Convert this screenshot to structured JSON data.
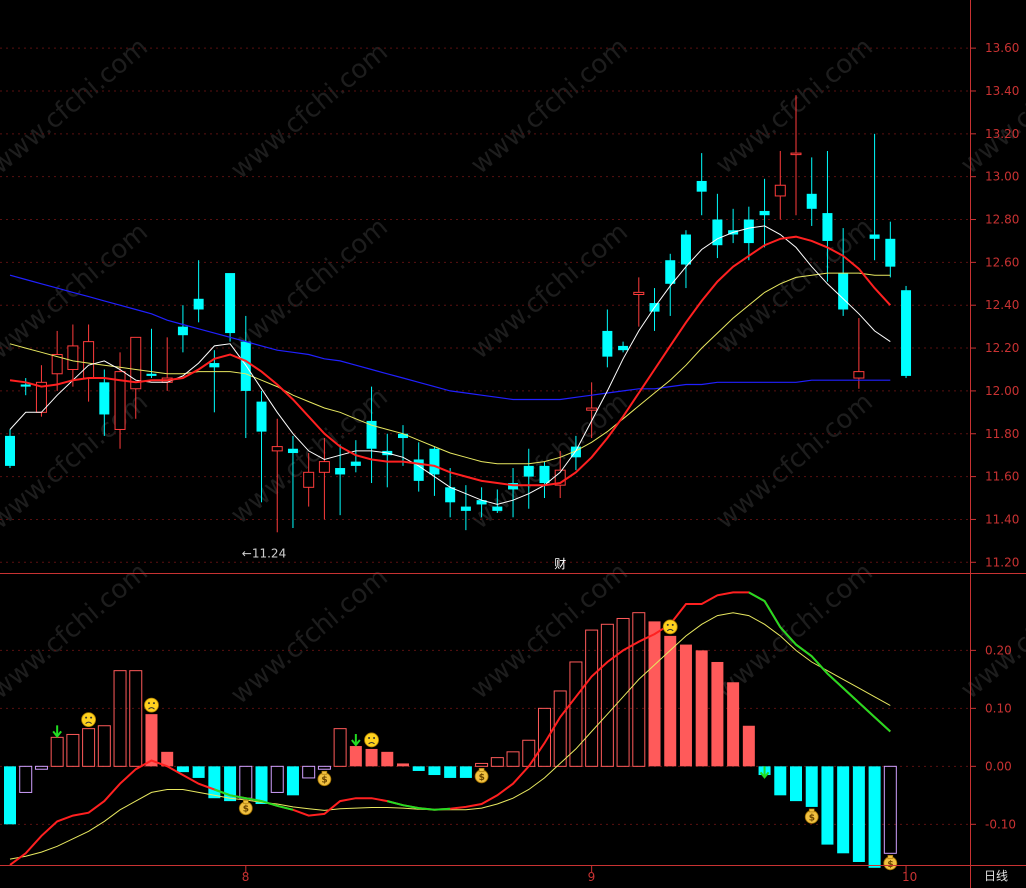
{
  "colors": {
    "background": "#000000",
    "axis_red": "#c83232",
    "up_candle": "#ff3c3c",
    "down_candle": "#00ffff",
    "ma_white": "#ffffff",
    "ma_red": "#ff2020",
    "ma_yellow": "#e8e860",
    "ma_blue": "#2020ff",
    "macd_pos": "#ff5a5a",
    "macd_neg": "#00ffff",
    "dif_green": "#22dd22"
  },
  "watermark": "www.cfchi.com",
  "finance_marker": "财",
  "period_label": "日线",
  "icons": {
    "sad_face": "sad-face-icon",
    "money_bag": "money-bag-icon",
    "down_arrow": "green-down-arrow-icon"
  },
  "chart_data": [
    {
      "type": "candlestick",
      "y_ticks": [
        "13.60",
        "13.40",
        "13.20",
        "13.00",
        "12.80",
        "12.60",
        "12.40",
        "12.20",
        "12.00",
        "11.80",
        "11.60",
        "11.40",
        "11.20"
      ],
      "ylim": [
        11.15,
        13.75
      ],
      "x_ticks": [
        {
          "label": "8",
          "index": 15
        },
        {
          "label": "9",
          "index": 37
        },
        {
          "label": "10",
          "index": 57
        }
      ],
      "low_annotation": {
        "text": "←11.24",
        "index": 15,
        "price": 11.24
      },
      "finance_index": 35,
      "ohlc": [
        [
          11.79,
          11.82,
          11.64,
          11.65
        ],
        [
          12.03,
          12.06,
          11.98,
          12.02
        ],
        [
          11.9,
          12.12,
          11.88,
          12.04
        ],
        [
          12.08,
          12.28,
          12.0,
          12.17
        ],
        [
          12.1,
          12.31,
          12.02,
          12.21
        ],
        [
          12.06,
          12.31,
          11.95,
          12.23
        ],
        [
          12.04,
          12.1,
          11.79,
          11.89
        ],
        [
          11.82,
          12.18,
          11.73,
          12.09
        ],
        [
          12.01,
          12.24,
          11.87,
          12.25
        ],
        [
          12.08,
          12.29,
          12.06,
          12.07
        ],
        [
          12.04,
          12.25,
          12.0,
          12.06
        ],
        [
          12.3,
          12.4,
          12.18,
          12.26
        ],
        [
          12.43,
          12.61,
          12.32,
          12.38
        ],
        [
          12.13,
          12.19,
          11.9,
          12.11
        ],
        [
          12.55,
          12.53,
          12.23,
          12.27
        ],
        [
          12.23,
          12.35,
          11.78,
          12.0
        ],
        [
          11.95,
          12.0,
          11.48,
          11.81
        ],
        [
          11.72,
          11.87,
          11.34,
          11.74
        ],
        [
          11.73,
          11.79,
          11.36,
          11.71
        ],
        [
          11.55,
          11.71,
          11.46,
          11.62
        ],
        [
          11.62,
          11.78,
          11.4,
          11.67
        ],
        [
          11.64,
          11.75,
          11.42,
          11.61
        ],
        [
          11.67,
          11.77,
          11.62,
          11.65
        ],
        [
          11.86,
          12.02,
          11.57,
          11.73
        ],
        [
          11.72,
          11.8,
          11.55,
          11.7
        ],
        [
          11.8,
          11.84,
          11.65,
          11.78
        ],
        [
          11.68,
          11.76,
          11.53,
          11.58
        ],
        [
          11.73,
          11.74,
          11.51,
          11.61
        ],
        [
          11.55,
          11.64,
          11.41,
          11.48
        ],
        [
          11.46,
          11.56,
          11.35,
          11.44
        ],
        [
          11.49,
          11.55,
          11.41,
          11.47
        ],
        [
          11.46,
          11.54,
          11.43,
          11.44
        ],
        [
          11.57,
          11.64,
          11.41,
          11.54
        ],
        [
          11.65,
          11.73,
          11.45,
          11.6
        ],
        [
          11.65,
          11.67,
          11.5,
          11.57
        ],
        [
          11.56,
          11.72,
          11.5,
          11.63
        ],
        [
          11.74,
          11.79,
          11.63,
          11.69
        ],
        [
          11.91,
          12.04,
          11.78,
          11.92
        ],
        [
          12.28,
          12.38,
          12.11,
          12.16
        ],
        [
          12.21,
          12.23,
          12.18,
          12.19
        ],
        [
          12.45,
          12.53,
          12.3,
          12.46
        ],
        [
          12.41,
          12.48,
          12.28,
          12.37
        ],
        [
          12.61,
          12.64,
          12.35,
          12.5
        ],
        [
          12.73,
          12.75,
          12.48,
          12.59
        ],
        [
          12.98,
          13.11,
          12.82,
          12.93
        ],
        [
          12.8,
          12.92,
          12.62,
          12.68
        ],
        [
          12.75,
          12.85,
          12.69,
          12.73
        ],
        [
          12.8,
          12.86,
          12.61,
          12.69
        ],
        [
          12.84,
          12.99,
          12.67,
          12.82
        ],
        [
          12.91,
          13.12,
          12.8,
          12.96
        ],
        [
          13.11,
          13.38,
          12.82,
          13.11
        ],
        [
          12.92,
          13.09,
          12.77,
          12.85
        ],
        [
          12.83,
          13.12,
          12.51,
          12.7
        ],
        [
          12.55,
          12.76,
          12.35,
          12.38
        ],
        [
          12.06,
          12.34,
          12.01,
          12.09
        ],
        [
          12.73,
          13.2,
          12.61,
          12.71
        ],
        [
          12.71,
          12.79,
          12.53,
          12.58
        ],
        [
          12.47,
          12.49,
          12.06,
          12.07
        ]
      ],
      "ma_white": [
        11.82,
        11.9,
        11.9,
        11.98,
        12.05,
        12.12,
        12.14,
        12.1,
        12.05,
        12.04,
        12.04,
        12.07,
        12.13,
        12.21,
        12.22,
        12.12,
        12.01,
        11.9,
        11.8,
        11.72,
        11.68,
        11.7,
        11.72,
        11.72,
        11.71,
        11.69,
        11.65,
        11.6,
        11.55,
        11.52,
        11.49,
        11.47,
        11.49,
        11.52,
        11.56,
        11.62,
        11.72,
        11.86,
        12.0,
        12.15,
        12.28,
        12.39,
        12.49,
        12.58,
        12.66,
        12.71,
        12.74,
        12.76,
        12.77,
        12.73,
        12.67,
        12.58,
        12.5,
        12.43,
        12.36,
        12.28,
        12.23
      ],
      "ma_red": [
        12.05,
        12.04,
        12.02,
        12.03,
        12.05,
        12.06,
        12.06,
        12.05,
        12.04,
        12.05,
        12.05,
        12.06,
        12.1,
        12.15,
        12.17,
        12.14,
        12.09,
        12.03,
        11.96,
        11.88,
        11.8,
        11.74,
        11.7,
        11.68,
        11.67,
        11.67,
        11.66,
        11.65,
        11.62,
        11.6,
        11.58,
        11.57,
        11.56,
        11.56,
        11.56,
        11.57,
        11.62,
        11.69,
        11.78,
        11.88,
        11.99,
        12.1,
        12.21,
        12.32,
        12.42,
        12.51,
        12.58,
        12.63,
        12.68,
        12.71,
        12.72,
        12.7,
        12.67,
        12.63,
        12.57,
        12.48,
        12.4
      ],
      "ma_yellow": [
        12.22,
        12.2,
        12.18,
        12.16,
        12.14,
        12.13,
        12.12,
        12.11,
        12.1,
        12.09,
        12.08,
        12.08,
        12.09,
        12.09,
        12.09,
        12.08,
        12.05,
        12.02,
        11.98,
        11.95,
        11.92,
        11.9,
        11.87,
        11.84,
        11.82,
        11.8,
        11.77,
        11.74,
        11.71,
        11.69,
        11.67,
        11.66,
        11.66,
        11.66,
        11.67,
        11.69,
        11.72,
        11.76,
        11.81,
        11.87,
        11.93,
        11.99,
        12.05,
        12.12,
        12.2,
        12.27,
        12.34,
        12.4,
        12.46,
        12.5,
        12.53,
        12.54,
        12.55,
        12.55,
        12.55,
        12.54,
        12.54
      ],
      "ma_blue": [
        12.54,
        12.52,
        12.5,
        12.48,
        12.46,
        12.44,
        12.42,
        12.4,
        12.38,
        12.36,
        12.33,
        12.31,
        12.29,
        12.27,
        12.25,
        12.23,
        12.21,
        12.19,
        12.18,
        12.17,
        12.15,
        12.14,
        12.12,
        12.1,
        12.08,
        12.06,
        12.04,
        12.02,
        12.0,
        11.99,
        11.98,
        11.97,
        11.96,
        11.96,
        11.96,
        11.96,
        11.97,
        11.98,
        11.99,
        12.0,
        12.01,
        12.01,
        12.02,
        12.03,
        12.03,
        12.04,
        12.04,
        12.04,
        12.04,
        12.04,
        12.04,
        12.05,
        12.05,
        12.05,
        12.05,
        12.05,
        12.05
      ]
    },
    {
      "type": "bar",
      "y_ticks": [
        "0.20",
        "0.10",
        "0.00",
        "-0.10"
      ],
      "ylim": [
        -0.165,
        0.33
      ],
      "macd": [
        -0.1,
        -0.045,
        -0.005,
        0.05,
        0.055,
        0.065,
        0.07,
        0.165,
        0.165,
        0.09,
        0.025,
        -0.01,
        -0.02,
        -0.055,
        -0.06,
        -0.055,
        -0.065,
        -0.045,
        -0.05,
        -0.02,
        -0.005,
        0.065,
        0.035,
        0.03,
        0.025,
        0.005,
        -0.008,
        -0.015,
        -0.02,
        -0.02,
        0.005,
        0.015,
        0.025,
        0.045,
        0.1,
        0.13,
        0.18,
        0.235,
        0.245,
        0.255,
        0.265,
        0.25,
        0.225,
        0.21,
        0.2,
        0.18,
        0.145,
        0.07,
        -0.015,
        -0.05,
        -0.06,
        -0.07,
        -0.135,
        -0.15,
        -0.165,
        -0.175,
        -0.15
      ],
      "dif": [
        -0.17,
        -0.15,
        -0.12,
        -0.095,
        -0.085,
        -0.08,
        -0.06,
        -0.03,
        -0.005,
        0.01,
        0.0,
        -0.015,
        -0.03,
        -0.04,
        -0.05,
        -0.055,
        -0.06,
        -0.068,
        -0.075,
        -0.085,
        -0.082,
        -0.06,
        -0.055,
        -0.055,
        -0.06,
        -0.067,
        -0.072,
        -0.075,
        -0.073,
        -0.07,
        -0.065,
        -0.05,
        -0.03,
        0.0,
        0.04,
        0.085,
        0.12,
        0.155,
        0.18,
        0.2,
        0.215,
        0.228,
        0.245,
        0.28,
        0.28,
        0.295,
        0.3,
        0.3,
        0.285,
        0.24,
        0.21,
        0.19,
        0.16,
        0.135,
        0.11,
        0.085,
        0.06
      ],
      "dea": [
        -0.16,
        -0.155,
        -0.148,
        -0.138,
        -0.125,
        -0.112,
        -0.095,
        -0.075,
        -0.06,
        -0.045,
        -0.04,
        -0.04,
        -0.045,
        -0.05,
        -0.055,
        -0.058,
        -0.062,
        -0.065,
        -0.07,
        -0.073,
        -0.076,
        -0.073,
        -0.072,
        -0.071,
        -0.071,
        -0.072,
        -0.074,
        -0.075,
        -0.075,
        -0.075,
        -0.072,
        -0.065,
        -0.055,
        -0.04,
        -0.02,
        0.005,
        0.03,
        0.06,
        0.09,
        0.12,
        0.15,
        0.175,
        0.2,
        0.225,
        0.245,
        0.26,
        0.265,
        0.26,
        0.245,
        0.225,
        0.2,
        0.18,
        0.165,
        0.15,
        0.135,
        0.12,
        0.105
      ],
      "dif_green_ranges": [
        [
          13,
          18
        ],
        [
          24,
          28
        ],
        [
          47,
          56
        ]
      ],
      "sad_indices": [
        5,
        9,
        23,
        42
      ],
      "money_indices": [
        15,
        20,
        30,
        51,
        56
      ],
      "arrow_indices": [
        3,
        22,
        48
      ]
    }
  ]
}
